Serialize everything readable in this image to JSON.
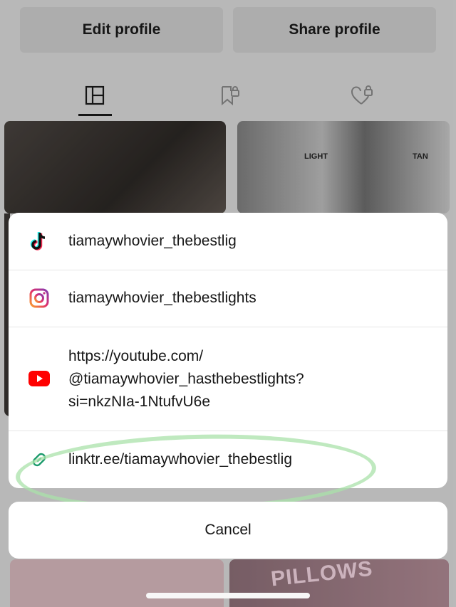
{
  "profile": {
    "edit_button": "Edit profile",
    "share_button": "Share profile",
    "tabs": [
      {
        "name": "videos-grid-icon"
      },
      {
        "name": "saved-locked-icon"
      },
      {
        "name": "liked-locked-icon"
      }
    ],
    "thumb_labels": {
      "light": "LIGHT",
      "tan": "TAN"
    },
    "pillows_text": "PILLOWS"
  },
  "sheet": {
    "items": [
      {
        "icon": "tiktok-icon",
        "label": "tiamaywhovier_thebestlig"
      },
      {
        "icon": "instagram-icon",
        "label": "tiamaywhovier_thebestlights"
      },
      {
        "icon": "youtube-icon",
        "label_lines": [
          "https://youtube.com/",
          "@tiamaywhovier_hasthebestlights?",
          "si=nkzNIa-1NtufvU6e"
        ]
      },
      {
        "icon": "link-icon",
        "label": "linktr.ee/tiamaywhovier_thebestlig"
      }
    ],
    "cancel_label": "Cancel"
  },
  "colors": {
    "youtube_red": "#ff0000",
    "highlight_green": "#aee1aa",
    "link_icon": "#1a9a6b"
  }
}
